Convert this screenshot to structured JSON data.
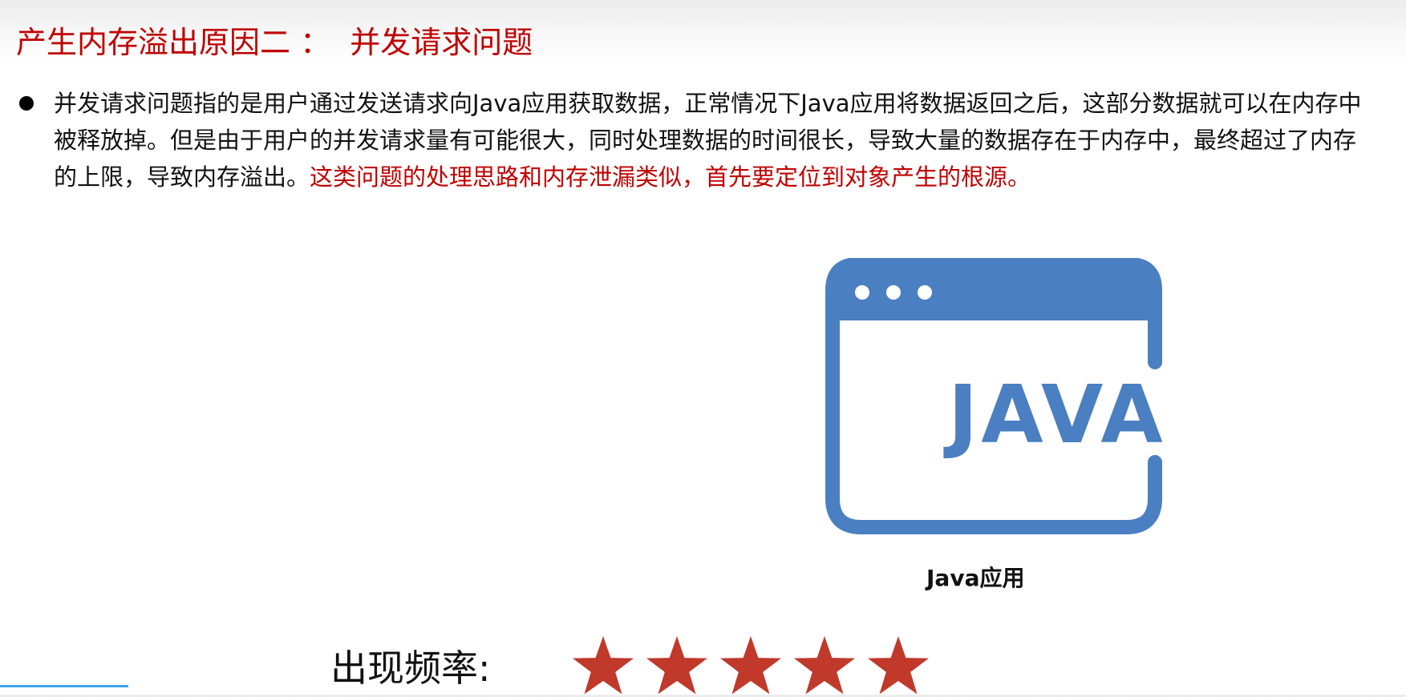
{
  "slide": {
    "title": "产生内存溢出原因二 ：  并发请求问题",
    "paragraph_normal": "并发请求问题指的是用户通过发送请求向Java应用获取数据，正常情况下Java应用将数据返回之后，这部分数据就可以在内存中被释放掉。但是由于用户的并发请求量有可能很大，同时处理数据的时间很长，导致大量的数据存在于内存中，最终超过了内存的上限，导致内存溢出。",
    "paragraph_highlight": "这类问题的处理思路和内存泄漏类似，首先要定位到对象产生的根源。",
    "java_logo_text": "JAVA",
    "java_caption": "Java应用",
    "frequency_label": "出现频率:",
    "frequency_rating": 5,
    "frequency_max": 5
  },
  "colors": {
    "accent_red": "#c00000",
    "java_blue": "#4a7fc1",
    "star_red": "#c0392b"
  },
  "icons": {
    "bullet": "bullet-dot",
    "window": "browser-window-icon",
    "star": "star-icon"
  }
}
